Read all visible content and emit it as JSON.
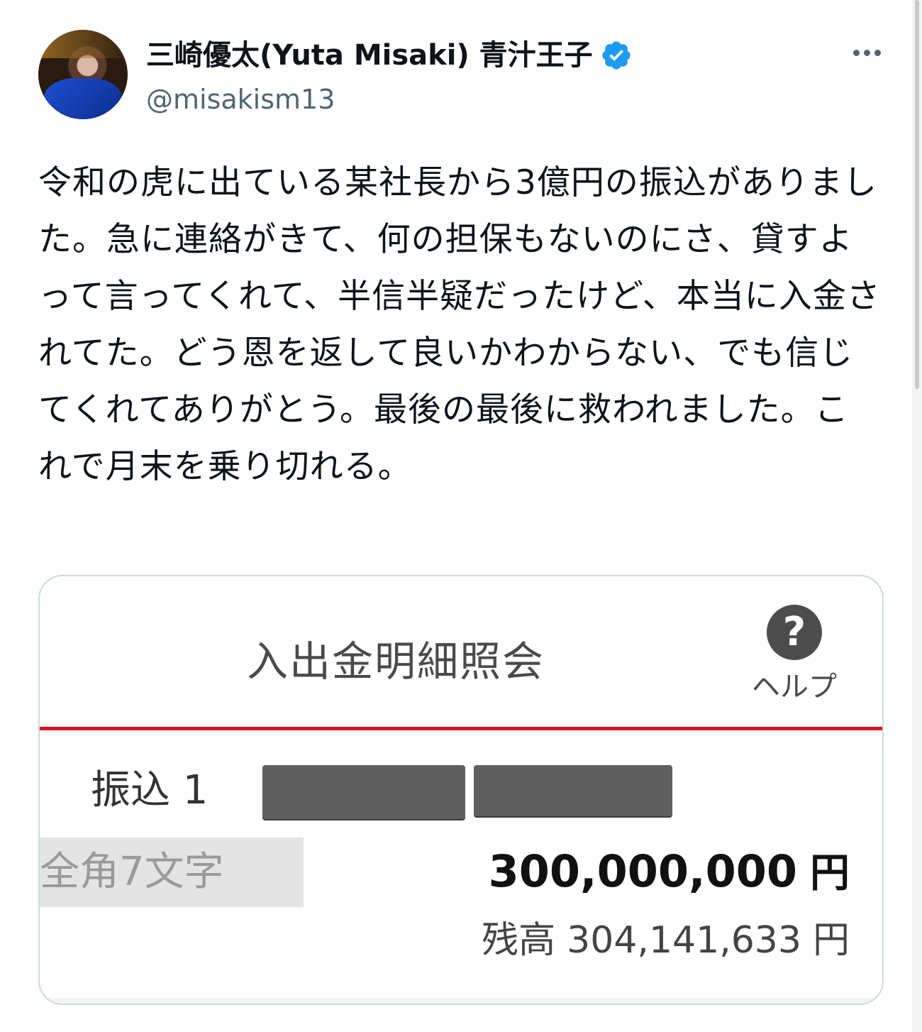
{
  "tweet": {
    "author": {
      "display_name": "三崎優太(Yuta Misaki) 青汁王子",
      "handle": "@misakism13",
      "verified": true,
      "verified_icon": "verified-badge-icon",
      "verified_color": "#1d9bf0"
    },
    "more_icon": "more-horizontal-icon",
    "text": "令和の虎に出ている某社長から3億円の振込がありました。急に連絡がきて、何の担保もないのにさ、貸すよって言ってくれて、半信半疑だったけど、本当に入金されてた。どう恩を返して良いかわからない、でも信じてくれてありがとう。最後の最後に救われました。これで月末を乗り切れる。"
  },
  "statement": {
    "title": "入出金明細照会",
    "help_icon": "question-circle-icon",
    "help_icon_glyph": "?",
    "help_label": "ヘルプ",
    "accent_color": "#d7141a",
    "transfer_label": "振込 1",
    "name_field_placeholder": "全角7文字",
    "amount": "300,000,000",
    "amount_unit": "円",
    "balance_label": "残高",
    "balance_value": "304,141,633",
    "balance_unit": "円"
  }
}
